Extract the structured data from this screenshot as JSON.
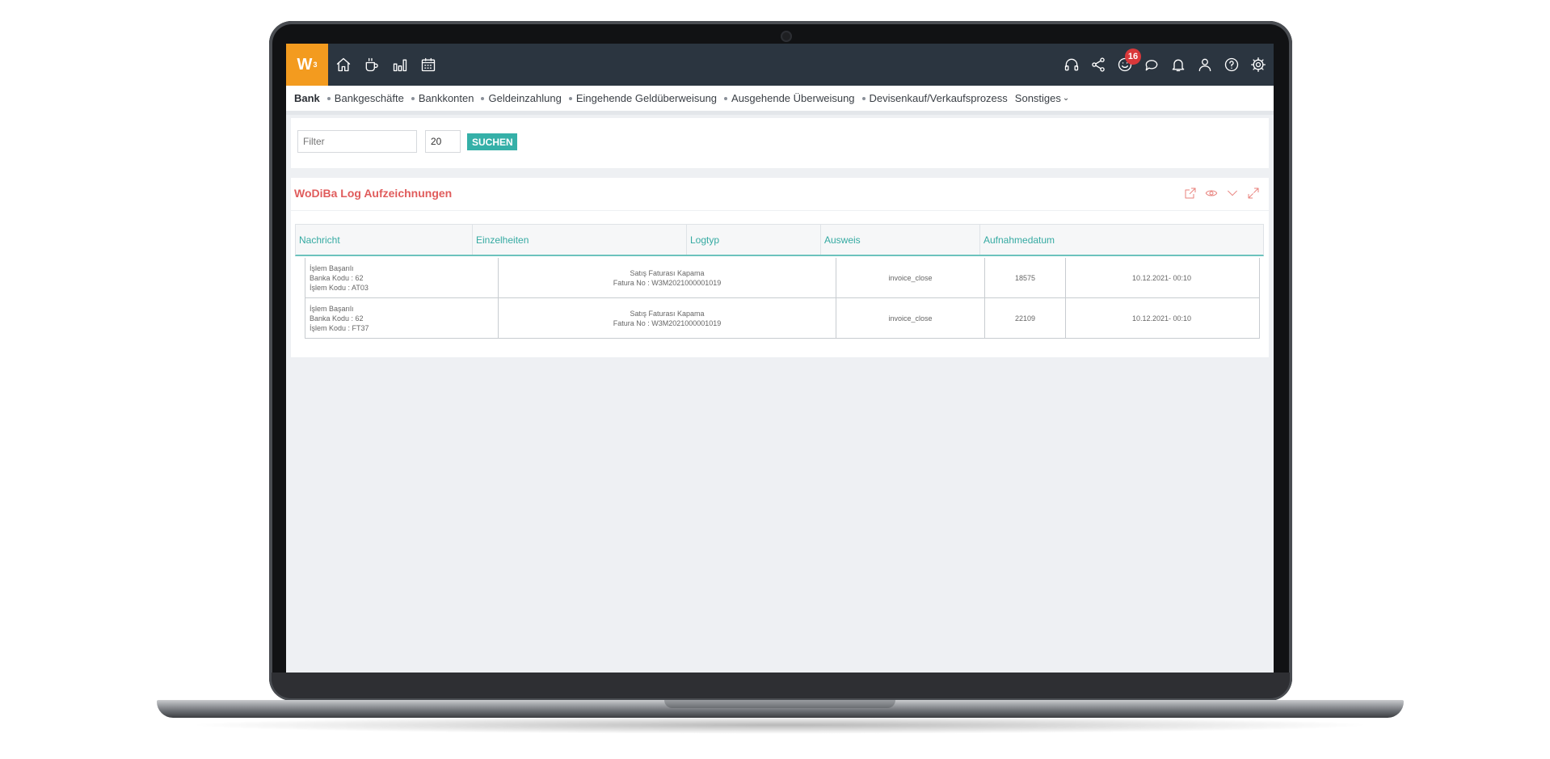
{
  "logo": {
    "text": "W",
    "superscript": "3"
  },
  "topbar": {
    "left_icons": [
      "home-icon",
      "coffee-icon",
      "bar-chart-icon",
      "calendar-icon"
    ],
    "right_icons": [
      "headset-icon",
      "share-icon",
      "smiley-icon",
      "chat-icon",
      "bell-icon",
      "user-icon",
      "help-icon",
      "gear-icon"
    ],
    "notification_badge": "16"
  },
  "menu": {
    "items": [
      {
        "label": "Bank",
        "active": true
      },
      {
        "label": "Bankgeschäfte"
      },
      {
        "label": "Bankkonten"
      },
      {
        "label": "Geldeinzahlung"
      },
      {
        "label": "Eingehende Geldüberweisung"
      },
      {
        "label": "Ausgehende Überweisung"
      },
      {
        "label": "Devisenkauf/Verkaufsprozess"
      },
      {
        "label": "Sonstiges"
      }
    ]
  },
  "filter": {
    "placeholder": "Filter",
    "count_value": "20",
    "search_label": "SUCHEN"
  },
  "log_panel": {
    "title": "WoDiBa Log Aufzeichnungen",
    "tools": [
      "external-link-icon",
      "eye-icon",
      "chevron-down-icon",
      "expand-icon"
    ],
    "columns": [
      "Nachricht",
      "Einzelheiten",
      "Logtyp",
      "Ausweis",
      "Aufnahmedatum"
    ],
    "rows": [
      {
        "message": [
          "İşlem Başarılı",
          "Banka Kodu : 62",
          "İşlem Kodu : AT03"
        ],
        "details": [
          "Satış Faturası Kapama",
          "Fatura No : W3M2021000001019"
        ],
        "logtype": "invoice_close",
        "id": "18575",
        "date": "10.12.2021- 00:10"
      },
      {
        "message": [
          "İşlem Başarılı",
          "Banka Kodu : 62",
          "İşlem Kodu : FT37"
        ],
        "details": [
          "Satış Faturası Kapama",
          "Fatura No : W3M2021000001019"
        ],
        "logtype": "invoice_close",
        "id": "22109",
        "date": "10.12.2021- 00:10"
      }
    ]
  },
  "colors": {
    "topbar": "#2b3540",
    "logo": "#f39b1f",
    "accent_teal": "#35b0a8",
    "title_red": "#e05c5c",
    "badge_red": "#d9383a"
  }
}
